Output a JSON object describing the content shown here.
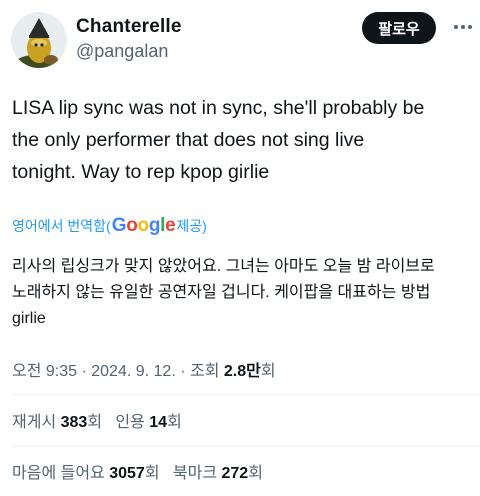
{
  "user": {
    "name": "Chanterelle",
    "handle": "@pangalan"
  },
  "header": {
    "follow_label": "팔로우"
  },
  "tweet": {
    "text": "LISA lip sync was not in sync, she'll probably be\nthe only performer that does not sing live\ntonight.  Way to rep kpop girlie",
    "translate_prefix": "영어에서 번역함(",
    "translate_brand": [
      "G",
      "o",
      "o",
      "g",
      "l",
      "e"
    ],
    "translate_suffix": " 제공)",
    "translated_text": "리사의 립싱크가 맞지 않았어요. 그녀는 아마도 오늘 밤 라이브로\n노래하지 않는 유일한 공연자일 겁니다. 케이팝을 대표하는 방법\ngirlie"
  },
  "meta": {
    "time": "오전 9:35",
    "sep1": " · ",
    "date": "2024. 9. 12.",
    "sep2": " · ",
    "views_label": "조회 ",
    "views_value": "2.8만",
    "views_suffix": "회"
  },
  "stats": {
    "reposts_label": "재게시 ",
    "reposts_value": "383",
    "reposts_suffix": "회",
    "quotes_label": "인용 ",
    "quotes_value": "14",
    "quotes_suffix": "회",
    "likes_label": "마음에 들어요 ",
    "likes_value": "3057",
    "likes_suffix": "회",
    "bookmarks_label": "북마크 ",
    "bookmarks_value": "272",
    "bookmarks_suffix": "회"
  },
  "icons": {
    "more": "more-horizontal-icon",
    "avatar": "avatar-image"
  },
  "colors": {
    "text": "#0f1419",
    "secondary": "#536471",
    "link": "#1d9bf0",
    "button_bg": "#0f1419",
    "divider": "#eff3f4"
  }
}
